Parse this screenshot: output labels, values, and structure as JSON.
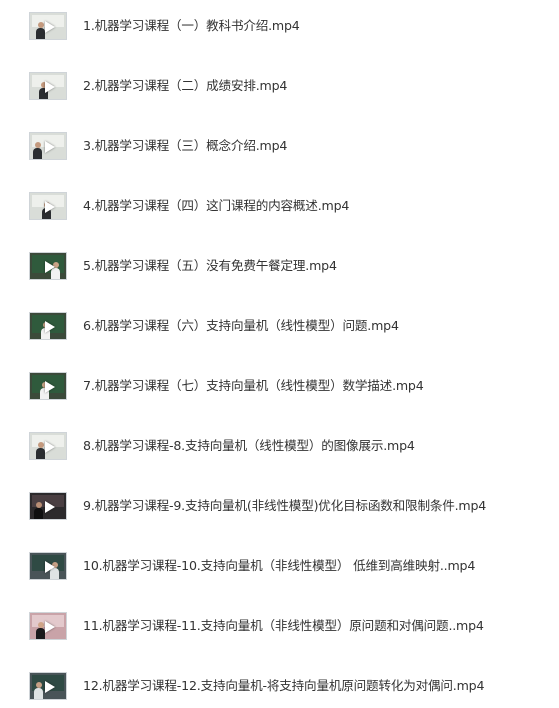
{
  "files": [
    {
      "name": "1.机器学习课程（一）教科书介绍.mp4",
      "thumbnail": "video-thumbnail"
    },
    {
      "name": "2.机器学习课程（二）成绩安排.mp4",
      "thumbnail": "video-thumbnail"
    },
    {
      "name": "3.机器学习课程（三）概念介绍.mp4",
      "thumbnail": "video-thumbnail"
    },
    {
      "name": "4.机器学习课程（四）这门课程的内容概述.mp4",
      "thumbnail": "video-thumbnail"
    },
    {
      "name": "5.机器学习课程（五）没有免费午餐定理.mp4",
      "thumbnail": "video-thumbnail"
    },
    {
      "name": "6.机器学习课程（六）支持向量机（线性模型）问题.mp4",
      "thumbnail": "video-thumbnail"
    },
    {
      "name": "7.机器学习课程（七）支持向量机（线性模型）数学描述.mp4",
      "thumbnail": "video-thumbnail"
    },
    {
      "name": "8.机器学习课程-8.支持向量机（线性模型）的图像展示.mp4",
      "thumbnail": "video-thumbnail"
    },
    {
      "name": "9.机器学习课程-9.支持向量机(非线性模型)优化目标函数和限制条件.mp4",
      "thumbnail": "video-thumbnail"
    },
    {
      "name": "10.机器学习课程-10.支持向量机（非线性模型） 低维到高维映射..mp4",
      "thumbnail": "video-thumbnail"
    },
    {
      "name": "11.机器学习课程-11.支持向量机（非线性模型）原问题和对偶问题..mp4",
      "thumbnail": "video-thumbnail"
    },
    {
      "name": "12.机器学习课程-12.支持向量机-将支持向量机原问题转化为对偶问.mp4",
      "thumbnail": "video-thumbnail"
    }
  ]
}
